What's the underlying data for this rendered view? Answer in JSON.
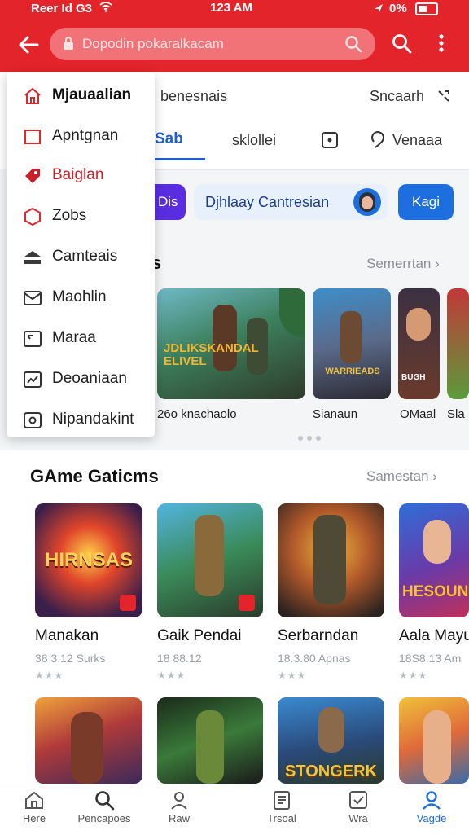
{
  "status_bar": {
    "left": "Reer Id G3",
    "time": "123 AM",
    "battery": "0%"
  },
  "address_bar": {
    "text": "Dopodin pokaralkacam"
  },
  "top_nav": {
    "label": "benesnais",
    "search_label": "Sncaarh"
  },
  "tabs": [
    {
      "label": "Sab"
    },
    {
      "label": "sklollei"
    },
    {
      "label": "Venaaa"
    }
  ],
  "filters": {
    "left_chip": "Dis",
    "center_chip": "Djhlaay Cantresian",
    "right_chip": "Kagi"
  },
  "section1": {
    "title_fragment": "s",
    "see_all": "Semerrtan ›",
    "items": [
      {
        "caption": "26o knachaolo"
      },
      {
        "caption": "Sianaun"
      },
      {
        "caption": "OMaal"
      },
      {
        "caption": "Sla"
      }
    ],
    "art": [
      {
        "text": "JDLIKSKANDAL ELIVEL"
      },
      {
        "text": "WARRIEADS"
      },
      {
        "text": "BUGH"
      }
    ]
  },
  "section2": {
    "title": "GAme Gaticms",
    "see_all": "Samestan ›",
    "games": [
      {
        "name": "Manakan",
        "meta": "38 3.12  Surks",
        "art": "HIRNSAS"
      },
      {
        "name": "Gaik Pendai",
        "meta": "18 88.12",
        "art": ""
      },
      {
        "name": "Serbarndan",
        "meta": "18.3.80  Apnas",
        "art": ""
      },
      {
        "name": "Aala Mayu",
        "meta": "18S8.13  Am",
        "art": "HESOUNI"
      }
    ],
    "row2_art": [
      {
        "text": ""
      },
      {
        "text": ""
      },
      {
        "text": "STONGERK"
      },
      {
        "text": ""
      }
    ]
  },
  "drawer": {
    "items": [
      {
        "label": "Mjauaalian",
        "icon": "home-icon"
      },
      {
        "label": "Apntgnan",
        "icon": "square-icon"
      },
      {
        "label": "Baiglan",
        "icon": "tag-icon"
      },
      {
        "label": "Zobs",
        "icon": "hexagon-icon"
      },
      {
        "label": "Camteais",
        "icon": "house-dark-icon"
      },
      {
        "label": "Maohlin",
        "icon": "mail-icon"
      },
      {
        "label": "Maraa",
        "icon": "card-icon"
      },
      {
        "label": "Deoaniaan",
        "icon": "chart-icon"
      },
      {
        "label": "Nipandakint",
        "icon": "box-icon"
      }
    ]
  },
  "bottom_nav": {
    "items": [
      {
        "label": "Here",
        "icon": "home-icon"
      },
      {
        "label": "Pencapoes",
        "icon": "search-icon"
      },
      {
        "label": "Raw",
        "icon": "person-icon"
      },
      {
        "label": "Trsoal",
        "icon": "list-icon"
      },
      {
        "label": "Wra",
        "icon": "check-icon"
      },
      {
        "label": "Vagde",
        "icon": "profile-icon",
        "active": true
      }
    ]
  },
  "colors": {
    "brand_red": "#e3242b",
    "accent_blue": "#1d5fd3",
    "chip_purple": "#5a2ee0"
  }
}
